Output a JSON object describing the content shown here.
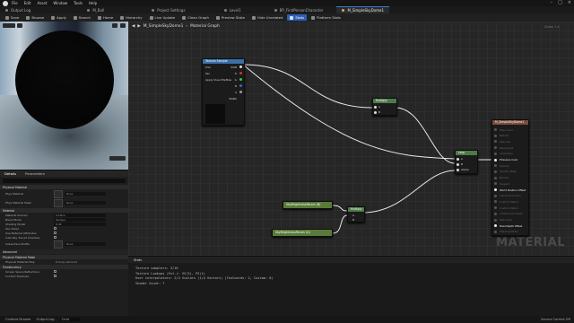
{
  "menu": {
    "items": [
      "File",
      "Edit",
      "Asset",
      "Window",
      "Tools",
      "Help"
    ]
  },
  "tabs": [
    "Output Log",
    "M_Ball",
    "Project Settings",
    "Level1",
    "BP_FirstPersonCharacter",
    "M_SimpleSkyDome1"
  ],
  "active_tab": "M_SimpleSkyDome1",
  "toolbar": {
    "items": [
      "Save",
      "Browse",
      "Apply",
      "Search",
      "Home",
      "Hierarchy",
      "Live Update",
      "Clean Graph",
      "Preview State",
      "Hide Unrelated",
      "Stats",
      "Platform Stats"
    ],
    "selected": "Stats"
  },
  "details": {
    "tabs": [
      "Details",
      "Parameters"
    ],
    "sections": [
      {
        "title": "Physical Material",
        "props": [
          {
            "label": "Phys Material",
            "value": "None",
            "thumb": true
          },
          {
            "label": "Phys Material Mask",
            "value": "None",
            "thumb": true
          }
        ]
      },
      {
        "title": "Material",
        "props": [
          {
            "label": "Material Domain",
            "value": "Surface"
          },
          {
            "label": "Blend Mode",
            "value": "Opaque"
          },
          {
            "label": "Shading Model",
            "value": "Unlit"
          },
          {
            "label": "Two Sided",
            "check": true
          },
          {
            "label": "Use Material Attributes",
            "check": true
          },
          {
            "label": "Cast Ray Traced Shadows",
            "check": true
          },
          {
            "label": "Subsurface Profile",
            "value": "None",
            "thumb": true
          }
        ]
      },
      {
        "title": "Advanced",
        "props": []
      },
      {
        "title": "Physical Material Mask",
        "props": [
          {
            "label": "Physical Material Map",
            "value": "8 Array elements"
          }
        ]
      },
      {
        "title": "Translucency",
        "props": [
          {
            "label": "Screen Space Reflections",
            "check": true
          },
          {
            "label": "Contact Shadows",
            "check": true
          }
        ]
      }
    ]
  },
  "graph": {
    "breadcrumb": [
      "M_SimpleSkyDome1",
      "Material Graph"
    ],
    "zoom": "Zoom 1:1",
    "watermark": "MATERIAL",
    "nodes": {
      "texture_sample": {
        "title": "Texture Sample",
        "pins_in": [
          "UVs",
          "Tex",
          "Apply View MipBias"
        ],
        "pins_out": [
          "RGB",
          "R",
          "G",
          "B",
          "A",
          "RGBA"
        ]
      },
      "multiply1": {
        "title": "Multiply",
        "pins_in": [
          "A",
          "B"
        ]
      },
      "lerp": {
        "title": "Lerp",
        "pins_in": [
          "A",
          "B",
          "Alpha"
        ]
      },
      "param1": {
        "title": "SkyBrightnessParam (B)"
      },
      "param2": {
        "title": "SkyBrightnessParam (G)"
      },
      "multiply2": {
        "title": "Multiply",
        "pins_in": [
          "A",
          "B"
        ]
      },
      "result": {
        "title": "M_SimpleSkyDome1",
        "pins": [
          "Base Color",
          "Metallic",
          "Specular",
          "Roughness",
          "Anisotropy",
          "Emissive Color",
          "Opacity",
          "Opacity Mask",
          "Normal",
          "Tangent",
          "World Position Offset",
          "Subsurface Color",
          "Custom Data 0",
          "Custom Data 1",
          "Ambient Occlusion",
          "Refraction",
          "Pixel Depth Offset",
          "Shading Model"
        ]
      }
    }
  },
  "output": {
    "title": "Stats",
    "lines": [
      "Texture samplers: 3/16",
      "Texture Lookups (Est.): VS(3), PS(1)",
      "User interpolators: 2/4 Scalars (1/4 Vectors) (TexCoords: 2, Custom: 0)",
      "Shader Count: 7"
    ]
  },
  "statusbar": {
    "items": [
      "Content Drawer",
      "Output Log",
      "Cmd"
    ],
    "right": "Source Control Off"
  },
  "colors": {
    "accent": "#2f5fb5",
    "graph_bg": "#262626",
    "node_bg": "#1b1b1b"
  }
}
